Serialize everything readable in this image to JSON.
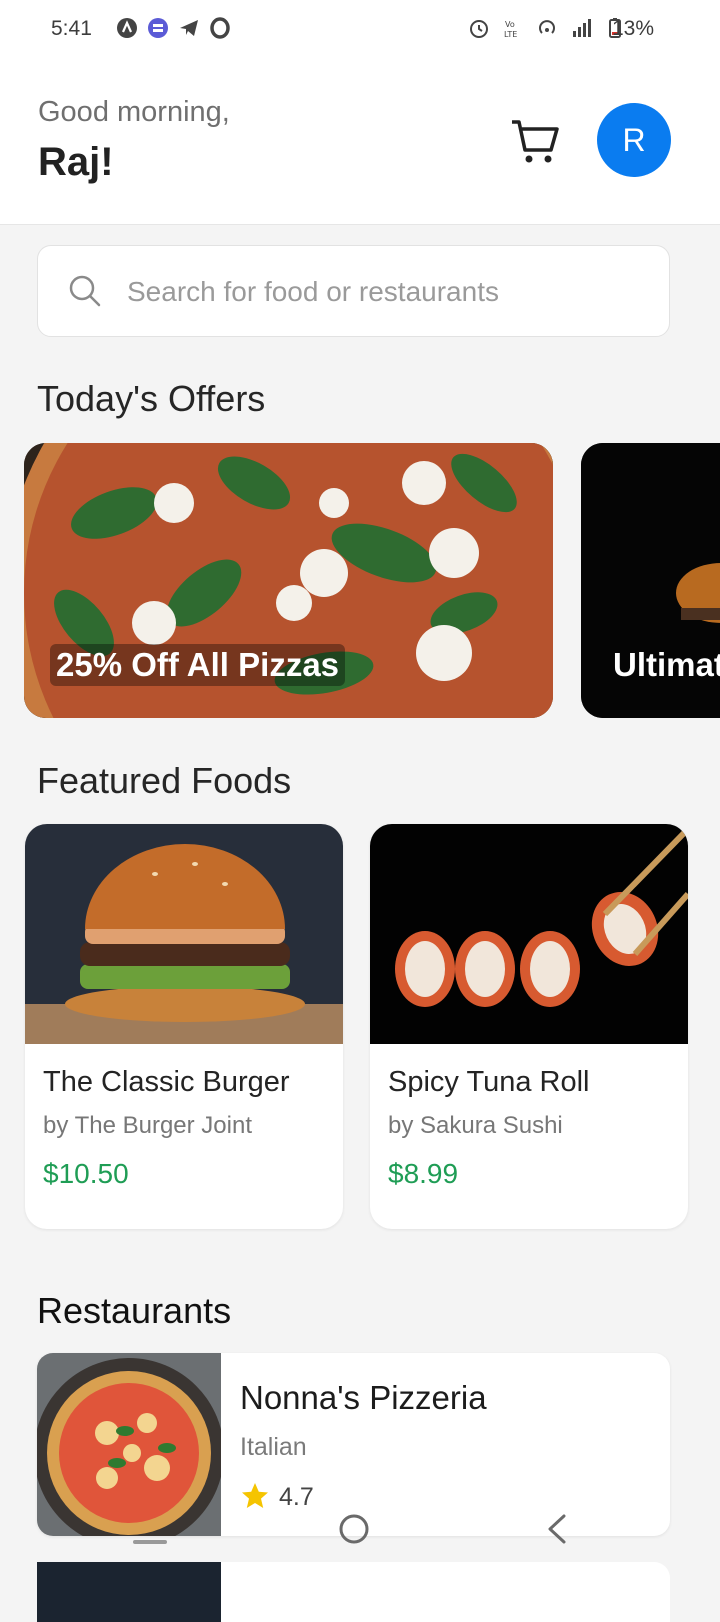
{
  "status_bar": {
    "time": "5:41",
    "battery": "13%",
    "left_icons": [
      "vpn-icon",
      "messenger-icon",
      "telegram-icon",
      "opera-icon"
    ],
    "right_icons": [
      "alarm-icon",
      "volte-icon",
      "hotspot-icon",
      "signal-icon",
      "battery-icon"
    ]
  },
  "header": {
    "greeting": "Good morning,",
    "name": "Raj!",
    "avatar_initial": "R",
    "accent_color": "#0a7cf0"
  },
  "search": {
    "placeholder": "Search for food or restaurants"
  },
  "offers": {
    "title": "Today's Offers",
    "items": [
      {
        "label": "25% Off All Pizzas"
      },
      {
        "label": "Ultimat"
      }
    ]
  },
  "featured": {
    "title": "Featured Foods",
    "price_color": "#1f9d55",
    "items": [
      {
        "name": "The Classic Burger",
        "by": "by The Burger Joint",
        "price": "$10.50"
      },
      {
        "name": "Spicy Tuna Roll",
        "by": "by Sakura Sushi",
        "price": "$8.99"
      }
    ]
  },
  "restaurants": {
    "title": "Restaurants",
    "items": [
      {
        "name": "Nonna's Pizzeria",
        "cuisine": "Italian",
        "rating": "4.7"
      }
    ]
  }
}
